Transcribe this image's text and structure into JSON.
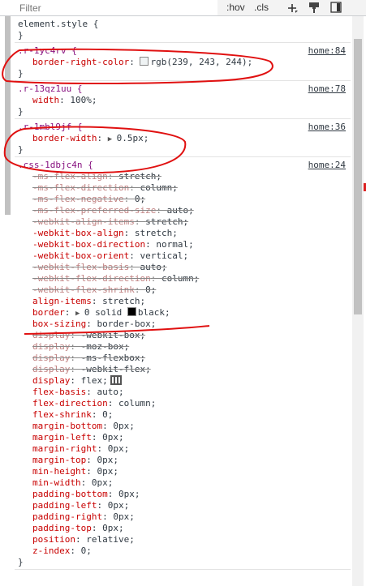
{
  "toolbar": {
    "filter_placeholder": "Filter",
    "hov_label": ":hov",
    "cls_label": ".cls",
    "icons": [
      "plus-icon",
      "paint-icon",
      "computed-sidebar-icon"
    ]
  },
  "rules": [
    {
      "selector": "element.style {",
      "source": "",
      "props": [],
      "close": "}"
    },
    {
      "selector": ".r-1yc4rv {",
      "source": "home:84",
      "props": [
        {
          "name": "border-right-color",
          "value": "rgb(239, 243, 244);",
          "swatch": "#eff3f4",
          "overridden": false
        }
      ],
      "close": "}"
    },
    {
      "selector": ".r-13qz1uu {",
      "source": "home:78",
      "props": [
        {
          "name": "width",
          "value": "100%;",
          "overridden": false
        }
      ],
      "close": "}"
    },
    {
      "selector": ".r-1mbl9jf {",
      "source": "home:36",
      "props": [
        {
          "name": "border-width",
          "value": "0.5px;",
          "expand": true,
          "overridden": false
        }
      ],
      "close": "}"
    },
    {
      "selector": ".css-1dbjc4n {",
      "source": "home:24",
      "props": [
        {
          "name": "-ms-flex-align",
          "value": "stretch;",
          "overridden": true
        },
        {
          "name": "-ms-flex-direction",
          "value": "column;",
          "overridden": true
        },
        {
          "name": "-ms-flex-negative",
          "value": "0;",
          "overridden": true
        },
        {
          "name": "-ms-flex-preferred-size",
          "value": "auto;",
          "overridden": true
        },
        {
          "name": "-webkit-align-items",
          "value": "stretch;",
          "overridden": true
        },
        {
          "name": "-webkit-box-align",
          "value": "stretch;",
          "overridden": false
        },
        {
          "name": "-webkit-box-direction",
          "value": "normal;",
          "overridden": false
        },
        {
          "name": "-webkit-box-orient",
          "value": "vertical;",
          "overridden": false
        },
        {
          "name": "-webkit-flex-basis",
          "value": "auto;",
          "overridden": true
        },
        {
          "name": "-webkit-flex-direction",
          "value": "column;",
          "overridden": true
        },
        {
          "name": "-webkit-flex-shrink",
          "value": "0;",
          "overridden": true
        },
        {
          "name": "align-items",
          "value": "stretch;",
          "overridden": false
        },
        {
          "name": "border",
          "value": "0 solid",
          "expand": true,
          "swatch": "#000000",
          "value2": "black;",
          "overridden": false
        },
        {
          "name": "box-sizing",
          "value": "border-box;",
          "overridden": false
        },
        {
          "name": "display",
          "value": "-webkit-box;",
          "overridden": true
        },
        {
          "name": "display",
          "value": "-moz-box;",
          "overridden": true
        },
        {
          "name": "display",
          "value": "-ms-flexbox;",
          "overridden": true
        },
        {
          "name": "display",
          "value": "-webkit-flex;",
          "overridden": true
        },
        {
          "name": "display",
          "value": "flex;",
          "flexicon": true,
          "overridden": false
        },
        {
          "name": "flex-basis",
          "value": "auto;",
          "overridden": false
        },
        {
          "name": "flex-direction",
          "value": "column;",
          "overridden": false
        },
        {
          "name": "flex-shrink",
          "value": "0;",
          "overridden": false
        },
        {
          "name": "margin-bottom",
          "value": "0px;",
          "overridden": false
        },
        {
          "name": "margin-left",
          "value": "0px;",
          "overridden": false
        },
        {
          "name": "margin-right",
          "value": "0px;",
          "overridden": false
        },
        {
          "name": "margin-top",
          "value": "0px;",
          "overridden": false
        },
        {
          "name": "min-height",
          "value": "0px;",
          "overridden": false
        },
        {
          "name": "min-width",
          "value": "0px;",
          "overridden": false
        },
        {
          "name": "padding-bottom",
          "value": "0px;",
          "overridden": false
        },
        {
          "name": "padding-left",
          "value": "0px;",
          "overridden": false
        },
        {
          "name": "padding-right",
          "value": "0px;",
          "overridden": false
        },
        {
          "name": "padding-top",
          "value": "0px;",
          "overridden": false
        },
        {
          "name": "position",
          "value": "relative;",
          "overridden": false
        },
        {
          "name": "z-index",
          "value": "0;",
          "overridden": false
        }
      ],
      "close": "}"
    }
  ],
  "colors": {
    "selector": "#881280",
    "property": "#c80000",
    "annotation": "#e01010"
  }
}
